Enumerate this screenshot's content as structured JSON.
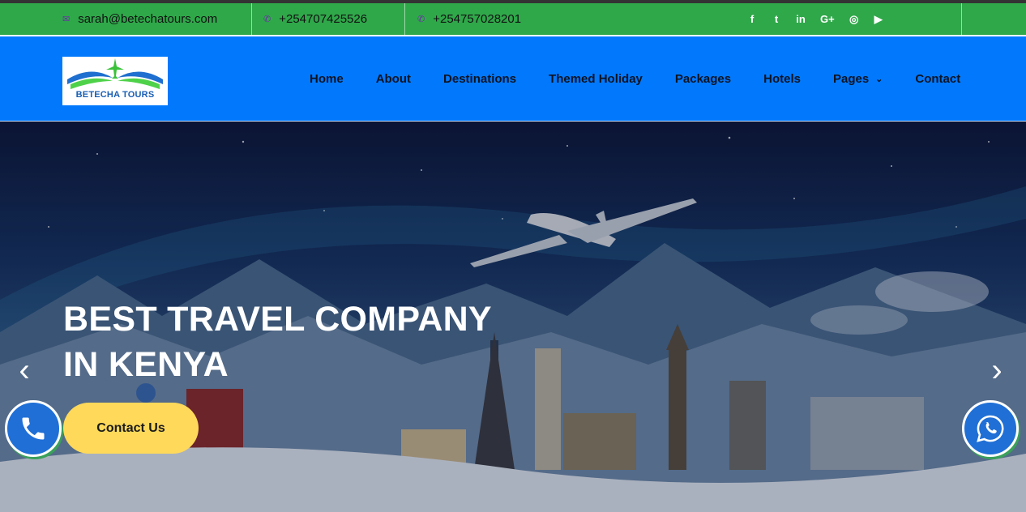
{
  "topbar": {
    "email": "sarah@betechatours.com",
    "phone_1": "+254707425526",
    "phone_2": "+254757028201",
    "email_icon": "envelope-icon",
    "phone_icon": "phone-icon",
    "social": [
      {
        "name": "facebook-icon",
        "glyph": "f"
      },
      {
        "name": "twitter-icon",
        "glyph": "t"
      },
      {
        "name": "linkedin-icon",
        "glyph": "in"
      },
      {
        "name": "google-plus-icon",
        "glyph": "G+"
      },
      {
        "name": "instagram-icon",
        "glyph": "◎"
      },
      {
        "name": "youtube-icon",
        "glyph": "▶"
      }
    ]
  },
  "header": {
    "logo_text": "BETECHA TOURS",
    "nav": {
      "home": "Home",
      "about": "About",
      "destinations": "Destinations",
      "themed_holiday": "Themed Holiday",
      "packages": "Packages",
      "hotels": "Hotels",
      "pages": "Pages",
      "contact": "Contact"
    }
  },
  "hero": {
    "headline_line1": "BEST TRAVEL COMPANY",
    "headline_line2": "IN KENYA",
    "cta_label": "Contact Us",
    "prev_glyph": "‹",
    "next_glyph": "›"
  },
  "colors": {
    "topbar": "#2fa84a",
    "header": "#0279fd",
    "cta": "#fed95a",
    "fab": "#1f6fd6"
  }
}
